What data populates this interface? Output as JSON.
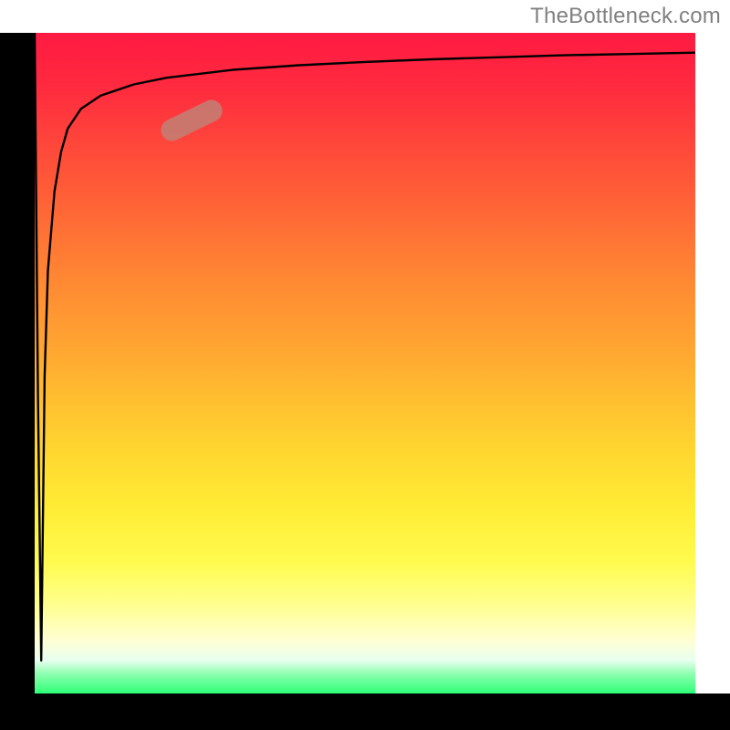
{
  "watermark": "TheBottleneck.com",
  "colors": {
    "line": "#000000",
    "highlight": "rgba(192,130,120,0.82)",
    "axis": "#000000",
    "watermark_text": "#808080"
  },
  "chart_data": {
    "type": "line",
    "title": "",
    "xlabel": "",
    "ylabel": "",
    "xlim": [
      0,
      100
    ],
    "ylim": [
      0,
      100
    ],
    "series": [
      {
        "name": "bottleneck-curve",
        "x": [
          0,
          0.5,
          1,
          1.5,
          2,
          3,
          4,
          5,
          7,
          10,
          15,
          20,
          30,
          40,
          50,
          60,
          70,
          80,
          90,
          100
        ],
        "values": [
          100,
          45,
          5,
          48,
          64,
          76,
          82,
          85.5,
          88.5,
          90.5,
          92.2,
          93.2,
          94.4,
          95.1,
          95.6,
          96.0,
          96.3,
          96.6,
          96.8,
          97.0
        ]
      }
    ],
    "highlight": {
      "series": "bottleneck-curve",
      "x_range": [
        18,
        28
      ],
      "y_range": [
        86,
        90
      ]
    },
    "grid": false,
    "legend": false
  }
}
